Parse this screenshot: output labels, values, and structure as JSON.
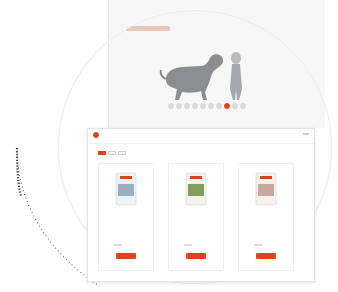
{
  "colors": {
    "accent": "#e3411e",
    "background": "#ffffff",
    "panel": "#f6f6f6"
  },
  "background_app": {
    "icon": "dog-silhouette-icon",
    "caption": "",
    "carousel_active_index": 7,
    "carousel_count": 10
  },
  "shop": {
    "logo_glyph": "",
    "title": "",
    "header_link": "",
    "language": "",
    "tabs": [
      {
        "label": "",
        "active": true
      },
      {
        "label": "",
        "active": false
      },
      {
        "label": "",
        "active": false
      }
    ],
    "filter_label": "",
    "products": [
      {
        "name": "",
        "weight": "",
        "price": "",
        "button": "",
        "pack_color": "#9bb0be"
      },
      {
        "name": "",
        "weight": "",
        "price": "",
        "button": "",
        "pack_color": "#7f9e5a"
      },
      {
        "name": "",
        "weight": "",
        "price": "",
        "button": "",
        "pack_color": "#c6a79e"
      }
    ]
  }
}
